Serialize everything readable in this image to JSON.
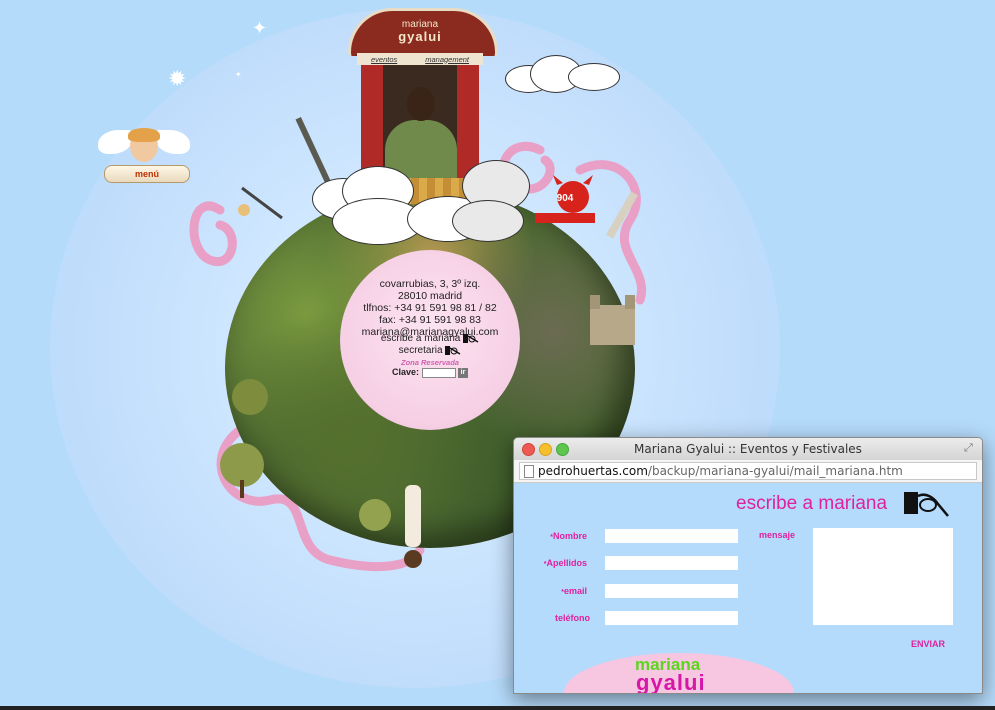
{
  "site": {
    "theatre": {
      "title_line1": "mariana",
      "title_line2": "gyalui",
      "nav": [
        "eventos",
        "management"
      ]
    },
    "menu_label": "menú",
    "contact": {
      "address_lines": [
        "covarrubias, 3, 3º izq.",
        "28010 madrid",
        "tlfnos: +34 91 591 98 81 / 82",
        "fax: +34 91 591 98 83",
        "mariana@marianagyalui.com"
      ],
      "write_link": "escribe a mariana",
      "secretary_link": "secretaria",
      "zone_label": "Zona Reservada",
      "password_label": "Clave:",
      "go_label": "ir"
    },
    "badge_number": "904"
  },
  "popup": {
    "window_title": "Mariana Gyalui :: Eventos y Festivales",
    "url_host": "pedrohuertas.com",
    "url_path": "/backup/mariana-gyalui/mail_mariana.htm",
    "heading": "escribe a mariana",
    "fields": [
      {
        "label": "Nombre",
        "required": true,
        "value": ""
      },
      {
        "label": "Apellidos",
        "required": true,
        "value": ""
      },
      {
        "label": "email",
        "required": true,
        "value": ""
      },
      {
        "label": "teléfono",
        "required": false,
        "value": ""
      }
    ],
    "message_label": "mensaje",
    "message_value": "",
    "send_label": "ENVIAR",
    "logo_line1": "mariana",
    "logo_line2": "gyalui"
  },
  "colors": {
    "background": "#b5dbfb",
    "accent_pink": "#e0219e",
    "logo_green": "#5bd61c",
    "menu_red": "#c23000"
  }
}
